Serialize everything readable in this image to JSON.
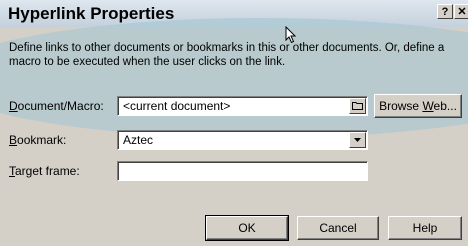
{
  "dialog": {
    "title": "Hyperlink Properties",
    "help_glyph": "?",
    "close_glyph": "✕",
    "description": "Define links to other documents or bookmarks in this or other documents. Or, define a macro to be executed when the user clicks on the link."
  },
  "fields": {
    "document_macro": {
      "label_pre": "",
      "label_key": "D",
      "label_post": "ocument/Macro:",
      "value": "<current document>"
    },
    "bookmark": {
      "label_pre": "",
      "label_key": "B",
      "label_post": "ookmark:",
      "value": "Aztec"
    },
    "target_frame": {
      "label_pre": "",
      "label_key": "T",
      "label_post": "arget frame:",
      "value": ""
    }
  },
  "buttons": {
    "browse_pre": "Browse ",
    "browse_key": "W",
    "browse_post": "eb...",
    "ok": "OK",
    "cancel": "Cancel",
    "help": "Help"
  },
  "icons": {
    "folder": "folder-icon",
    "dropdown": "chevron-down-icon",
    "pointer": "mouse-pointer-icon"
  }
}
